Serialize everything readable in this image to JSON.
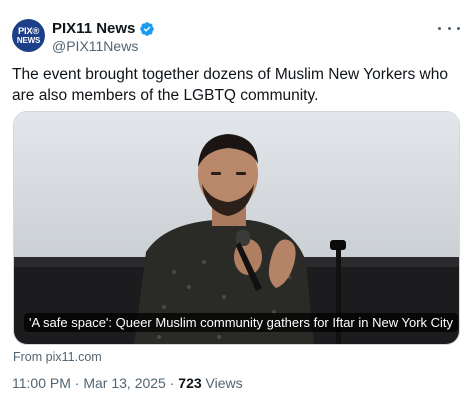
{
  "author": {
    "name": "PIX11 News",
    "handle": "@PIX11News",
    "avatar_line1": "PIX®",
    "avatar_line2": "NEWS",
    "verified": true,
    "verified_color": "#1d9bf0"
  },
  "tweet": {
    "text": "The event brought together dozens of Muslim New Yorkers who are also members of the LGBTQ community."
  },
  "card": {
    "caption": "'A safe space': Queer Muslim community gathers for Iftar in New York City",
    "source": "From pix11.com"
  },
  "meta": {
    "time": "11:00 PM",
    "sep1": " · ",
    "date": "Mar 13, 2025",
    "sep2": " · ",
    "views_count": "723",
    "views_label": " Views"
  },
  "icons": {
    "more": "more-dots-icon",
    "verified": "verified-badge-icon"
  }
}
